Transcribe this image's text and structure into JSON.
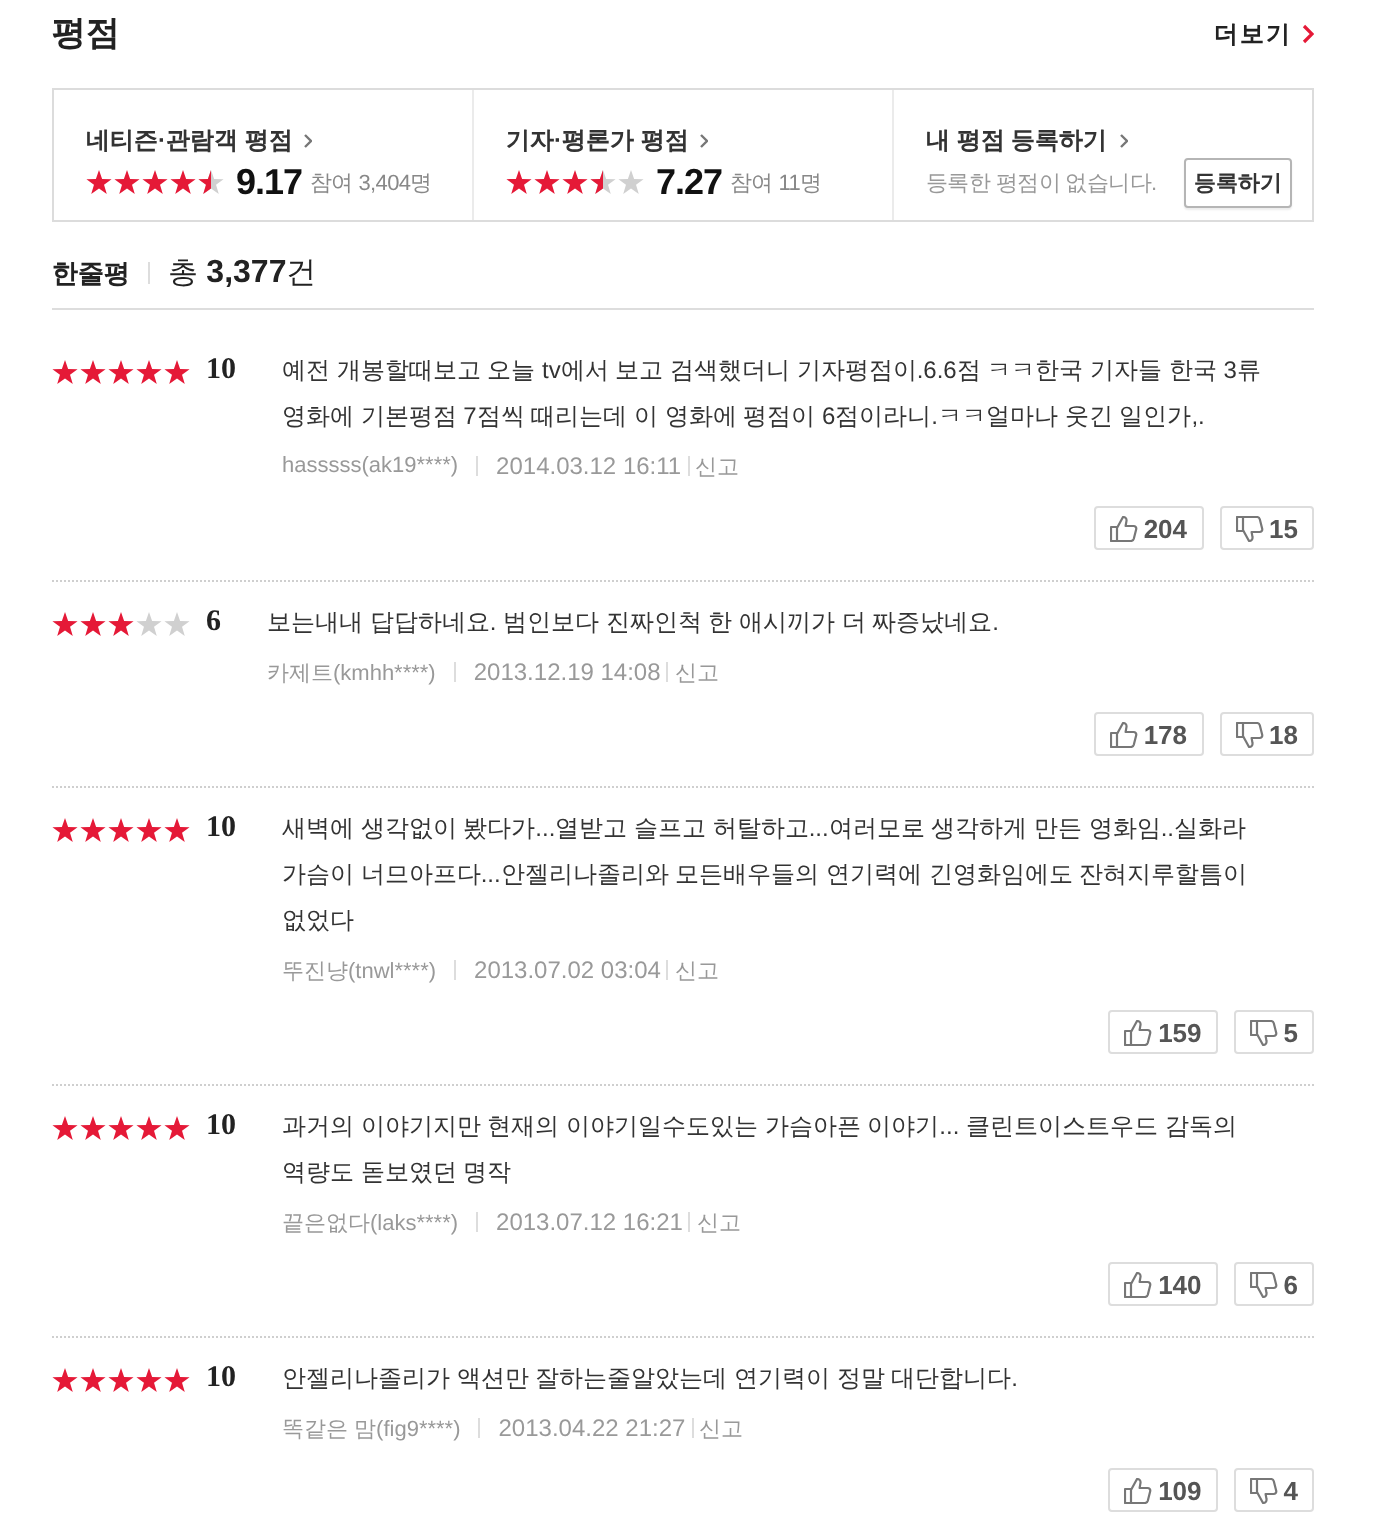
{
  "header": {
    "title": "평점",
    "more_link": "더보기"
  },
  "summary": [
    {
      "kind": "rating",
      "label": "네티즌·관람객 평점",
      "stars": 4.5,
      "score": "9.17",
      "participants": "참여 3,404명"
    },
    {
      "kind": "rating",
      "label": "기자·평론가 평점",
      "stars": 3.5,
      "score": "7.27",
      "participants": "참여 11명"
    },
    {
      "kind": "register",
      "label": "내 평점 등록하기",
      "message": "등록한 평점이 없습니다.",
      "button": "등록하기"
    }
  ],
  "reviews_header": {
    "title": "한줄평",
    "total": "총 **3,377**건"
  },
  "reviews": [
    {
      "stars": 5,
      "score": "10",
      "text": "예전 개봉할때보고 오늘 tv에서 보고 검색했더니 기자평점이.6.6점 ㅋㅋ한국 기자들 한국 3류 영화에 기본평점 7점씩 때리는데 이 영화에 평점이 6점이라니.ㅋㅋ얼마나 웃긴 일인가,.",
      "author": "hasssss(ak19****)",
      "date": "2014.03.12 16:11",
      "report": "신고",
      "likes": "204",
      "dislikes": "15"
    },
    {
      "stars": 3,
      "score": "6",
      "text": "보는내내 답답하네요. 범인보다 진짜인척 한 애시끼가 더 짜증났네요.",
      "author": "카제트(kmhh****)",
      "date": "2013.12.19 14:08",
      "report": "신고",
      "likes": "178",
      "dislikes": "18"
    },
    {
      "stars": 5,
      "score": "10",
      "text": "새벽에 생각없이 봤다가...열받고 슬프고 허탈하고...여러모로 생각하게 만든 영화임..실화라 가슴이 너므아프다...안젤리나졸리와 모든배우들의 연기력에 긴영화임에도 잔혀지루할틈이 없었다",
      "author": "뚜진냥(tnwl****)",
      "date": "2013.07.02 03:04",
      "report": "신고",
      "likes": "159",
      "dislikes": "5"
    },
    {
      "stars": 5,
      "score": "10",
      "text": "과거의 이야기지만 현재의 이야기일수도있는 가슴아픈 이야기... 클린트이스트우드 감독의 역량도 돋보였던 명작",
      "author": "끝은없다(laks****)",
      "date": "2013.07.12 16:21",
      "report": "신고",
      "likes": "140",
      "dislikes": "6"
    },
    {
      "stars": 5,
      "score": "10",
      "text": "안젤리나졸리가 액션만 잘하는줄알았는데 연기력이 정말 대단합니다.",
      "author": "똑같은 맘(fig9****)",
      "date": "2013.04.22 21:27",
      "report": "신고",
      "likes": "109",
      "dislikes": "4"
    }
  ]
}
